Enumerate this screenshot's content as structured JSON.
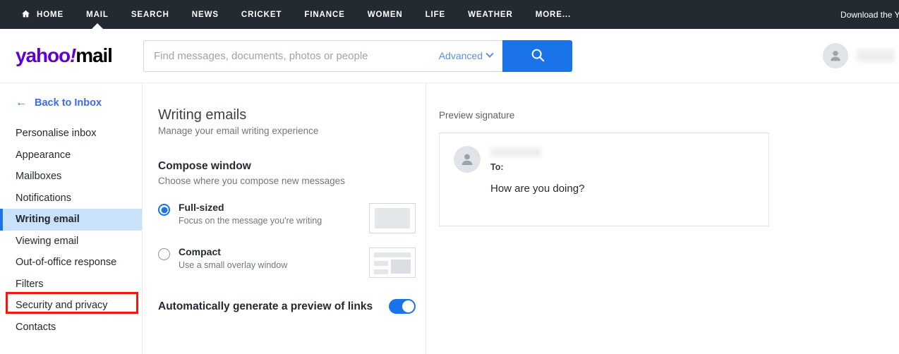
{
  "topnav": {
    "items": [
      {
        "label": "HOME",
        "icon": "home-icon",
        "active": false
      },
      {
        "label": "MAIL",
        "active": true
      },
      {
        "label": "SEARCH",
        "active": false
      },
      {
        "label": "NEWS",
        "active": false
      },
      {
        "label": "CRICKET",
        "active": false
      },
      {
        "label": "FINANCE",
        "active": false
      },
      {
        "label": "WOMEN",
        "active": false
      },
      {
        "label": "LIFE",
        "active": false
      },
      {
        "label": "WEATHER",
        "active": false
      },
      {
        "label": "MORE...",
        "active": false
      }
    ],
    "download_link": "Download the Yah",
    "background": "#232a31"
  },
  "header": {
    "logo_yahoo": "yahoo",
    "logo_bang": "!",
    "logo_mail": "mail",
    "search": {
      "placeholder": "Find messages, documents, photos or people",
      "value": "",
      "advanced_label": "Advanced",
      "button_icon": "search-icon",
      "button_color": "#1a73e8"
    },
    "account_name_redacted": ""
  },
  "sidebar": {
    "back_label": "Back to Inbox",
    "items": [
      {
        "label": "Personalise inbox",
        "active": false
      },
      {
        "label": "Appearance",
        "active": false
      },
      {
        "label": "Mailboxes",
        "active": false
      },
      {
        "label": "Notifications",
        "active": false
      },
      {
        "label": "Writing email",
        "active": true
      },
      {
        "label": "Viewing email",
        "active": false
      },
      {
        "label": "Out-of-office response",
        "active": false
      },
      {
        "label": "Filters",
        "active": false
      },
      {
        "label": "Security and privacy",
        "active": false
      },
      {
        "label": "Contacts",
        "active": false
      }
    ],
    "highlight_color": "#ef1a0f",
    "active_background": "#c9e2f9"
  },
  "settings": {
    "title": "Writing emails",
    "subtitle": "Manage your email writing experience",
    "section_title": "Compose window",
    "section_subtitle": "Choose where you compose new messages",
    "options": [
      {
        "label": "Full-sized",
        "description": "Focus on the message you're writing",
        "selected": true
      },
      {
        "label": "Compact",
        "description": "Use a small overlay window",
        "selected": false
      }
    ],
    "link_preview": {
      "label": "Automatically generate a preview of links",
      "enabled": true,
      "on_color": "#1a73e8"
    }
  },
  "preview": {
    "title": "Preview signature",
    "sender_redacted": "",
    "to_label": "To:",
    "body_text": "How are you doing?"
  }
}
